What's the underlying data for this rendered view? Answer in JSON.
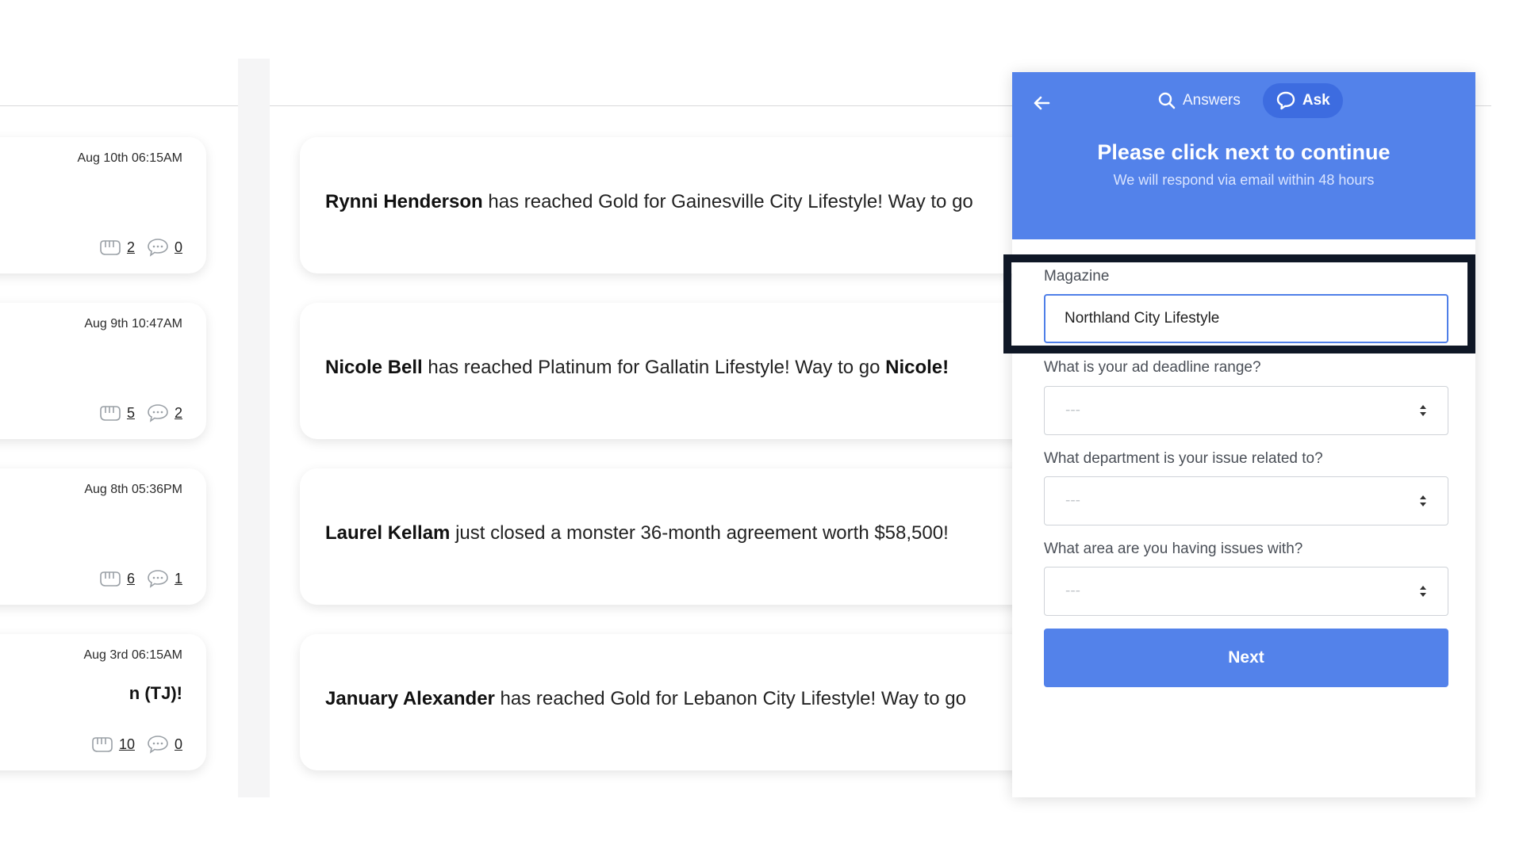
{
  "left_cards": [
    {
      "date": "Aug 10th 06:15AM",
      "snippet": "",
      "fist_count": "2",
      "comment_count": "0"
    },
    {
      "date": "Aug 9th 10:47AM",
      "snippet": "",
      "fist_count": "5",
      "comment_count": "2"
    },
    {
      "date": "Aug 8th 05:36PM",
      "snippet": "",
      "fist_count": "6",
      "comment_count": "1"
    },
    {
      "date": "Aug 3rd 06:15AM",
      "snippet": "n (TJ)!",
      "fist_count": "10",
      "comment_count": "0"
    }
  ],
  "feed": [
    {
      "name": "Rynni Henderson",
      "text": " has reached Gold for Gainesville City Lifestyle! Way to go "
    },
    {
      "name": "Nicole Bell",
      "text": " has reached Platinum for Gallatin Lifestyle! Way to go ",
      "tail": "Nicole!"
    },
    {
      "name": "Laurel Kellam",
      "text": " just closed a monster 36-month agreement worth $58,500!"
    },
    {
      "name": "January Alexander",
      "text": " has reached Gold for Lebanon City Lifestyle! Way to go "
    }
  ],
  "widget": {
    "tabs": {
      "answers": "Answers",
      "ask": "Ask"
    },
    "title": "Please click next to continue",
    "subtitle": "We will respond via email within 48 hours",
    "magazine_label": "Magazine",
    "magazine_value": "Northland City Lifestyle",
    "deadline_label": "What is your ad deadline range?",
    "deadline_value": "---",
    "department_label": "What department is your issue related to?",
    "department_value": "---",
    "area_label": "What area are you having issues with?",
    "area_value": "---",
    "next_label": "Next"
  },
  "colors": {
    "header_blue": "#5382ea",
    "active_tab": "#3d6ce0",
    "highlight_border": "#0f1726"
  }
}
